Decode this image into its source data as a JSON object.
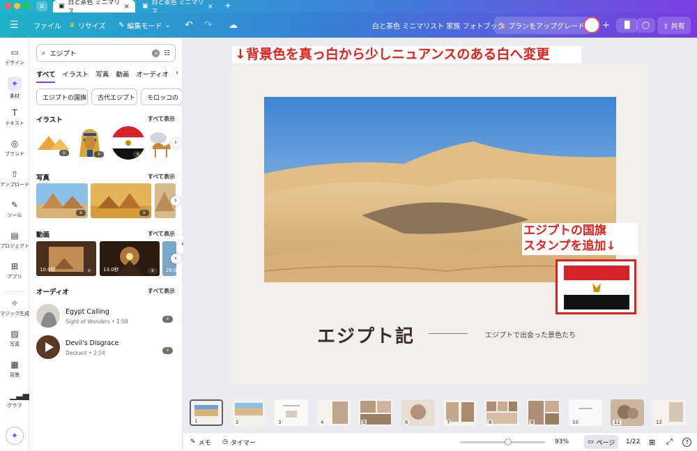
{
  "tabs": [
    {
      "label": "白と茶色 ミニマリス...",
      "active": true
    },
    {
      "label": "白と茶色 ミニマリス...",
      "active": false
    }
  ],
  "toolbar": {
    "file": "ファイル",
    "resize": "リサイズ",
    "edit_mode": "編集モード",
    "doc_title": "白と茶色 ミニマリスト 家族 フォトブック",
    "upgrade": "プランをアップグレード",
    "share": "共有"
  },
  "sidebar": [
    {
      "label": "デザイン",
      "icon": "layout-icon"
    },
    {
      "label": "素材",
      "icon": "elements-icon"
    },
    {
      "label": "テキスト",
      "icon": "text-icon"
    },
    {
      "label": "ブランド",
      "icon": "brand-icon"
    },
    {
      "label": "アップロード",
      "icon": "upload-icon"
    },
    {
      "label": "ツール",
      "icon": "tools-icon"
    },
    {
      "label": "プロジェクト",
      "icon": "folder-icon"
    },
    {
      "label": "アプリ",
      "icon": "apps-icon"
    },
    {
      "label": "マジック生成",
      "icon": "magic-icon"
    },
    {
      "label": "写真",
      "icon": "photo-icon"
    },
    {
      "label": "背景",
      "icon": "background-icon"
    },
    {
      "label": "グラフ",
      "icon": "chart-icon"
    }
  ],
  "panel": {
    "search_value": "エジプト",
    "filters": [
      "すべて",
      "イラスト",
      "写真",
      "動画",
      "オーディオ"
    ],
    "chips": [
      "エジプトの国旗",
      "古代エジプト",
      "モロッコの"
    ],
    "see_all": "すべて表示",
    "sections": {
      "illust": "イラスト",
      "photo": "写真",
      "video": "動画",
      "audio": "オーディオ"
    },
    "videos": [
      "10.0秒",
      "13.0秒",
      "28.0"
    ],
    "audio": [
      {
        "title": "Egypt Calling",
        "sub": "Sight of Wonders • 1:58"
      },
      {
        "title": "Devil's Disgrace",
        "sub": "Deskant • 2:24"
      }
    ]
  },
  "canvas": {
    "annotation_top": "↓背景色を真っ白から少しニュアンスのある白へ変更",
    "annotation_flag_1": "エジプトの国旗",
    "annotation_flag_2": "スタンプを追加↓",
    "title": "エジプト記",
    "subtitle": "エジプトで出会った景色たち"
  },
  "pages": [
    "1",
    "2",
    "3",
    "4",
    "5",
    "6",
    "7",
    "8",
    "9",
    "10",
    "11",
    "12"
  ],
  "bottom": {
    "notes": "メモ",
    "timer": "タイマー",
    "zoom": "93%",
    "pages_btn": "ページ",
    "page_count": "1/22"
  },
  "colors": {
    "accent": "#8b3dff",
    "annotation": "#e3211b"
  }
}
